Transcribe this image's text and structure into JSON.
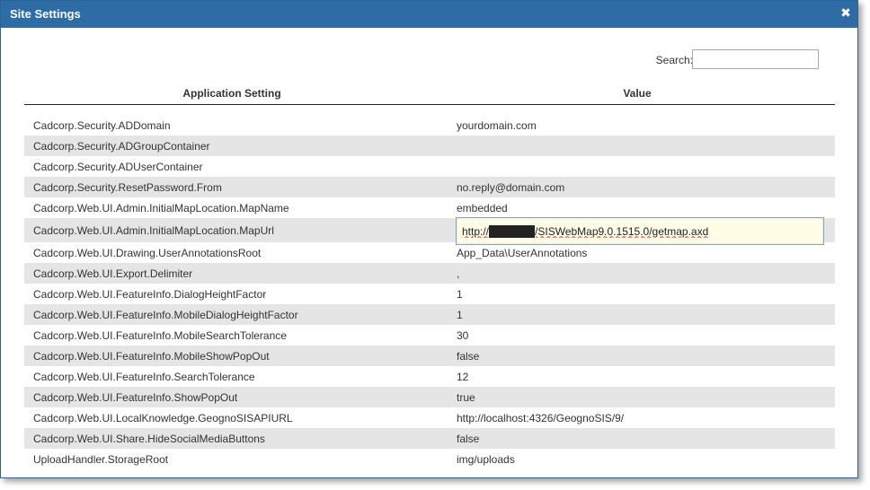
{
  "dialog": {
    "title": "Site Settings",
    "close_icon": "close-icon"
  },
  "search": {
    "label": "Search:",
    "value": ""
  },
  "table": {
    "columns": [
      "Application Setting",
      "Value"
    ],
    "rows": [
      {
        "setting": "Cadcorp.Security.ADDomain",
        "value": "yourdomain.com"
      },
      {
        "setting": "Cadcorp.Security.ADGroupContainer",
        "value": ""
      },
      {
        "setting": "Cadcorp.Security.ADUserContainer",
        "value": ""
      },
      {
        "setting": "Cadcorp.Security.ResetPassword.From",
        "value": "no.reply@domain.com"
      },
      {
        "setting": "Cadcorp.Web.UI.Admin.InitialMapLocation.MapName",
        "value": "embedded"
      },
      {
        "setting": "Cadcorp.Web.UI.Admin.InitialMapLocation.MapUrl",
        "value": "http://██████/SISWebMap9.0.1515.0/getmap.axd",
        "editing": true
      },
      {
        "setting": "Cadcorp.Web.UI.Drawing.UserAnnotationsRoot",
        "value": "App_Data\\UserAnnotations"
      },
      {
        "setting": "Cadcorp.Web.UI.Export.Delimiter",
        "value": ","
      },
      {
        "setting": "Cadcorp.Web.UI.FeatureInfo.DialogHeightFactor",
        "value": "1"
      },
      {
        "setting": "Cadcorp.Web.UI.FeatureInfo.MobileDialogHeightFactor",
        "value": "1"
      },
      {
        "setting": "Cadcorp.Web.UI.FeatureInfo.MobileSearchTolerance",
        "value": "30"
      },
      {
        "setting": "Cadcorp.Web.UI.FeatureInfo.MobileShowPopOut",
        "value": "false"
      },
      {
        "setting": "Cadcorp.Web.UI.FeatureInfo.SearchTolerance",
        "value": "12"
      },
      {
        "setting": "Cadcorp.Web.UI.FeatureInfo.ShowPopOut",
        "value": "true"
      },
      {
        "setting": "Cadcorp.Web.UI.LocalKnowledge.GeognoSISAPIURL",
        "value": "http://localhost:4326/GeognoSIS/9/"
      },
      {
        "setting": "Cadcorp.Web.UI.Share.HideSocialMediaButtons",
        "value": "false"
      },
      {
        "setting": "UploadHandler.StorageRoot",
        "value": "img/uploads"
      }
    ]
  },
  "colors": {
    "titlebar": "#2d6ca5",
    "row_alt": "#e5e5e5",
    "edit_bg": "#fffce8"
  }
}
